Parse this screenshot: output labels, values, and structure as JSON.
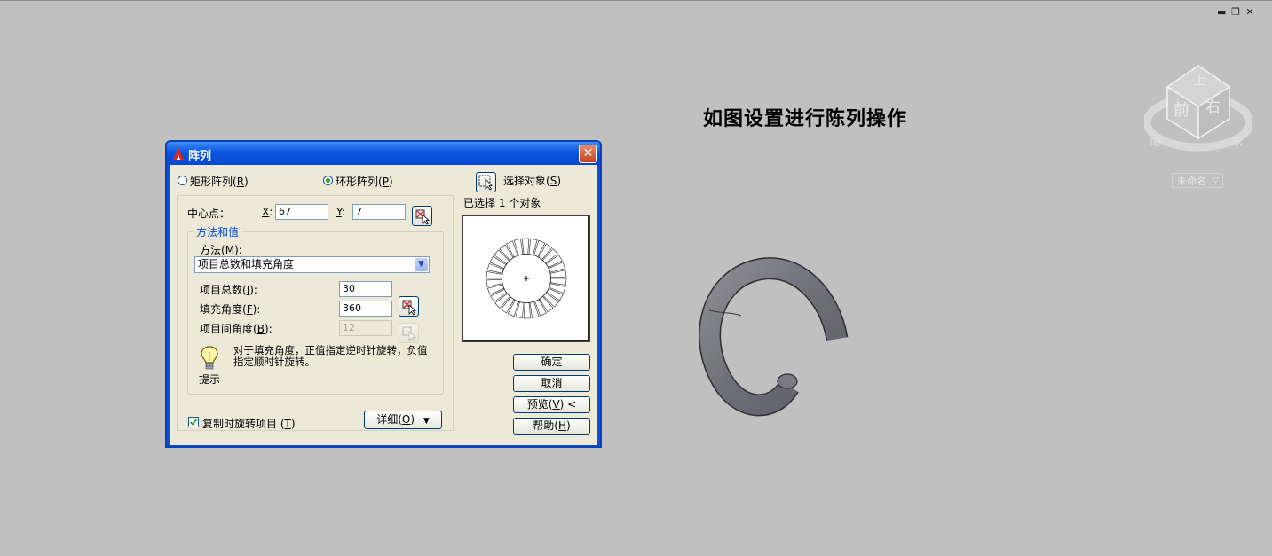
{
  "window_controls": {
    "minimize": "▬",
    "restore": "❐",
    "close": "✕"
  },
  "caption": "如图设置进行陈列操作",
  "viewcube": {
    "top": "上",
    "front": "前",
    "right": "右",
    "south": "南",
    "east": "东"
  },
  "view_name": "未命名",
  "dialog": {
    "title": "阵列",
    "close": "✕",
    "rect_array": {
      "label": "矩形阵列",
      "key": "R"
    },
    "polar_array": {
      "label": "环形阵列",
      "key": "P"
    },
    "selected_mode": "polar",
    "center_label": "中心点：",
    "x_label": "X",
    "x_value": "67",
    "y_label": "Y",
    "y_value": "7",
    "method_group": "方法和值",
    "method_label": "方法",
    "method_key": "M",
    "method_value": "项目总数和填充角度",
    "total_label": "项目总数",
    "total_key": "I",
    "total_value": "30",
    "fill_label": "填充角度",
    "fill_key": "F",
    "fill_value": "360",
    "between_label": "项目间角度",
    "between_key": "B",
    "between_value": "12",
    "tip_text": "对于填充角度，正值指定逆时针旋转，负值指定顺时针旋转。",
    "tip_caption": "提示",
    "rotate_label": "复制时旋转项目",
    "rotate_key": "T",
    "rotate_checked": true,
    "detail_button": "详细",
    "detail_key": "O",
    "select_objects": "选择对象",
    "select_key": "S",
    "selected_count": "已选择 1 个对象",
    "ok": "确定",
    "cancel": "取消",
    "preview_btn": "预览",
    "preview_key": "V",
    "help": "帮助",
    "help_key": "H"
  }
}
